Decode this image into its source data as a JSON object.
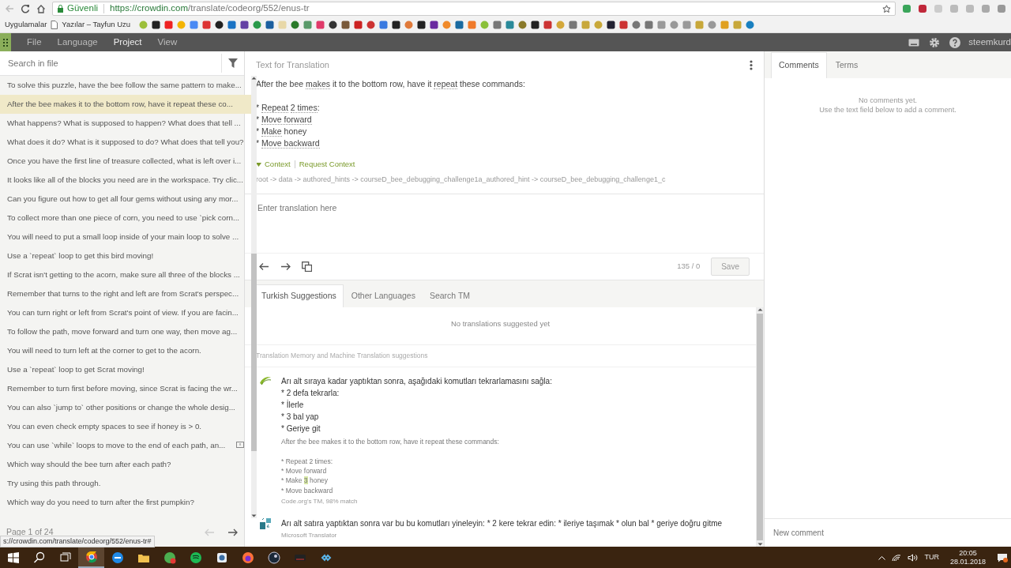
{
  "browser": {
    "secure_label": "Güvenli",
    "url_host": "https://crowdin.com",
    "url_path": "/translate/codeorg/552/enus-tr",
    "bookmarks": [
      "Uygulamalar",
      "Yazılar – Tayfun Uzu"
    ],
    "status_url": "s://crowdin.com/translate/codeorg/552/enus-tr#"
  },
  "menu": [
    {
      "label": "File",
      "selected": false
    },
    {
      "label": "Language",
      "selected": false
    },
    {
      "label": "Project",
      "selected": true
    },
    {
      "label": "View",
      "selected": false
    }
  ],
  "user": "steemkurd",
  "sidebar": {
    "search": {
      "placeholder": "Search in file"
    },
    "items": [
      {
        "text": "To solve this puzzle, have the bee follow the same pattern to make...",
        "selected": false,
        "flagged": false
      },
      {
        "text": "After the bee makes it to the bottom row, have it repeat these co...",
        "selected": true,
        "flagged": false
      },
      {
        "text": "What happens? What is supposed to happen? What does that tell ...",
        "selected": false,
        "flagged": false
      },
      {
        "text": "What does it do? What is it supposed to do? What does that tell you?",
        "selected": false,
        "flagged": false
      },
      {
        "text": "Once you have the first line of treasure collected, what is left over i...",
        "selected": false,
        "flagged": false
      },
      {
        "text": "It looks like all of the blocks you need are in the workspace. Try clic...",
        "selected": false,
        "flagged": false
      },
      {
        "text": "Can you figure out how to get all four gems without using any mor...",
        "selected": false,
        "flagged": false
      },
      {
        "text": "To collect more than one piece of corn, you need to use `pick corn...",
        "selected": false,
        "flagged": false
      },
      {
        "text": "You will need to put a small loop inside of your main loop to solve ...",
        "selected": false,
        "flagged": false
      },
      {
        "text": "Use a `repeat` loop to get this bird moving!",
        "selected": false,
        "flagged": false
      },
      {
        "text": "If Scrat isn't getting to the acorn, make sure all three of the blocks ...",
        "selected": false,
        "flagged": false
      },
      {
        "text": "Remember that turns to the right and left are from Scrat's perspec...",
        "selected": false,
        "flagged": false
      },
      {
        "text": "You can turn right or left from Scrat's point of view. If you are facin...",
        "selected": false,
        "flagged": false
      },
      {
        "text": "To follow the path, move forward and turn one way, then move ag...",
        "selected": false,
        "flagged": false
      },
      {
        "text": "You will need to turn left at the corner to get to the acorn.",
        "selected": false,
        "flagged": false
      },
      {
        "text": "Use a `repeat` loop to get Scrat moving!",
        "selected": false,
        "flagged": false
      },
      {
        "text": "Remember to turn first before moving, since Scrat is facing the wr...",
        "selected": false,
        "flagged": false
      },
      {
        "text": "You can also `jump to` other positions or change the whole desig...",
        "selected": false,
        "flagged": false
      },
      {
        "text": "You can even check empty spaces to see if honey is > 0.",
        "selected": false,
        "flagged": false
      },
      {
        "text": "You can use `while` loops to move to the end of each path, an...",
        "selected": false,
        "flagged": true
      },
      {
        "text": "Which way should the bee turn after each path?",
        "selected": false,
        "flagged": false
      },
      {
        "text": "Try using this path through.",
        "selected": false,
        "flagged": false
      },
      {
        "text": "Which way do you need to turn after the first pumpkin?",
        "selected": false,
        "flagged": false
      }
    ],
    "page_label": "Page 1 of 24"
  },
  "source": {
    "title": "Text for Translation",
    "paragraphs": [
      [
        [
          {
            "text": "After the bee ",
            "term": false
          },
          {
            "text": "makes",
            "term": true
          },
          {
            "text": " it to the bottom row, have it ",
            "term": false
          },
          {
            "text": "repeat",
            "term": true
          },
          {
            "text": " these commands:",
            "term": false
          }
        ]
      ],
      [
        [
          {
            "text": "* ",
            "term": false
          },
          {
            "text": "Repeat",
            "term": true
          },
          {
            "text": "2 times",
            "term": true
          },
          {
            "text": ":",
            "term": false
          }
        ],
        [
          {
            "text": "* ",
            "term": false
          },
          {
            "text": "Move forward",
            "term": true
          }
        ],
        [
          {
            "text": "* ",
            "term": false
          },
          {
            "text": "Make",
            "term": true
          },
          {
            "text": " honey",
            "term": false
          }
        ],
        [
          {
            "text": "* ",
            "term": false
          },
          {
            "text": "Move backward",
            "term": true
          }
        ]
      ]
    ],
    "context_toggle": "Context",
    "request_context": "Request Context",
    "path": "root -> data -> authored_hints -> courseD_bee_debugging_challenge1a_authored_hint -> courseD_bee_debugging_challenge1_c"
  },
  "translation": {
    "placeholder": "Enter translation here",
    "counter": "135 / 0",
    "save": "Save"
  },
  "suggestion_tabs": [
    {
      "label": "Turkish Suggestions",
      "selected": true
    },
    {
      "label": "Other Languages",
      "selected": false
    },
    {
      "label": "Search TM",
      "selected": false
    }
  ],
  "no_suggestions": "No translations suggested yet",
  "tm_header": "Translation Memory and Machine Translation suggestions",
  "suggestions": [
    {
      "kind": "tm",
      "lines": [
        "Arı alt sıraya kadar yaptıktan sonra, aşağıdaki komutları tekrarlamasını sağla:",
        "* 2 defa tekrarla:",
        "* İlerle",
        "* 3 bal yap",
        "* Geriye git"
      ],
      "source_paragraphs": [
        [
          [
            {
              "text": "After the bee makes it to the bottom row, have it repeat these commands:",
              "highlight": false
            }
          ]
        ],
        [
          [
            {
              "text": "* Repeat 2 times:",
              "highlight": false
            }
          ],
          [
            {
              "text": "* Move forward",
              "highlight": false
            }
          ],
          [
            {
              "text": "* Make ",
              "highlight": false
            },
            {
              "text": "3",
              "highlight": true
            },
            {
              "text": " honey",
              "highlight": false
            }
          ],
          [
            {
              "text": "* Move backward",
              "highlight": false
            }
          ]
        ]
      ],
      "origin": "Code.org's TM, 98% match"
    },
    {
      "kind": "mt",
      "lines": [
        "Arı alt satıra yaptıktan sonra var bu bu komutları yineleyin: * 2 kere tekrar edin: * ileriye taşımak * olun bal * geriye doğru gitme"
      ],
      "origin": "Microsoft Translator"
    }
  ],
  "comment_tabs": [
    {
      "label": "Comments",
      "selected": true
    },
    {
      "label": "Terms",
      "selected": false
    }
  ],
  "comments_empty": [
    "No comments yet.",
    "Use the text field below to add a comment."
  ],
  "comment_field": {
    "placeholder": "New comment"
  },
  "taskbar": {
    "language": "TUR",
    "time": "20:05",
    "date": "28.01.2018"
  }
}
